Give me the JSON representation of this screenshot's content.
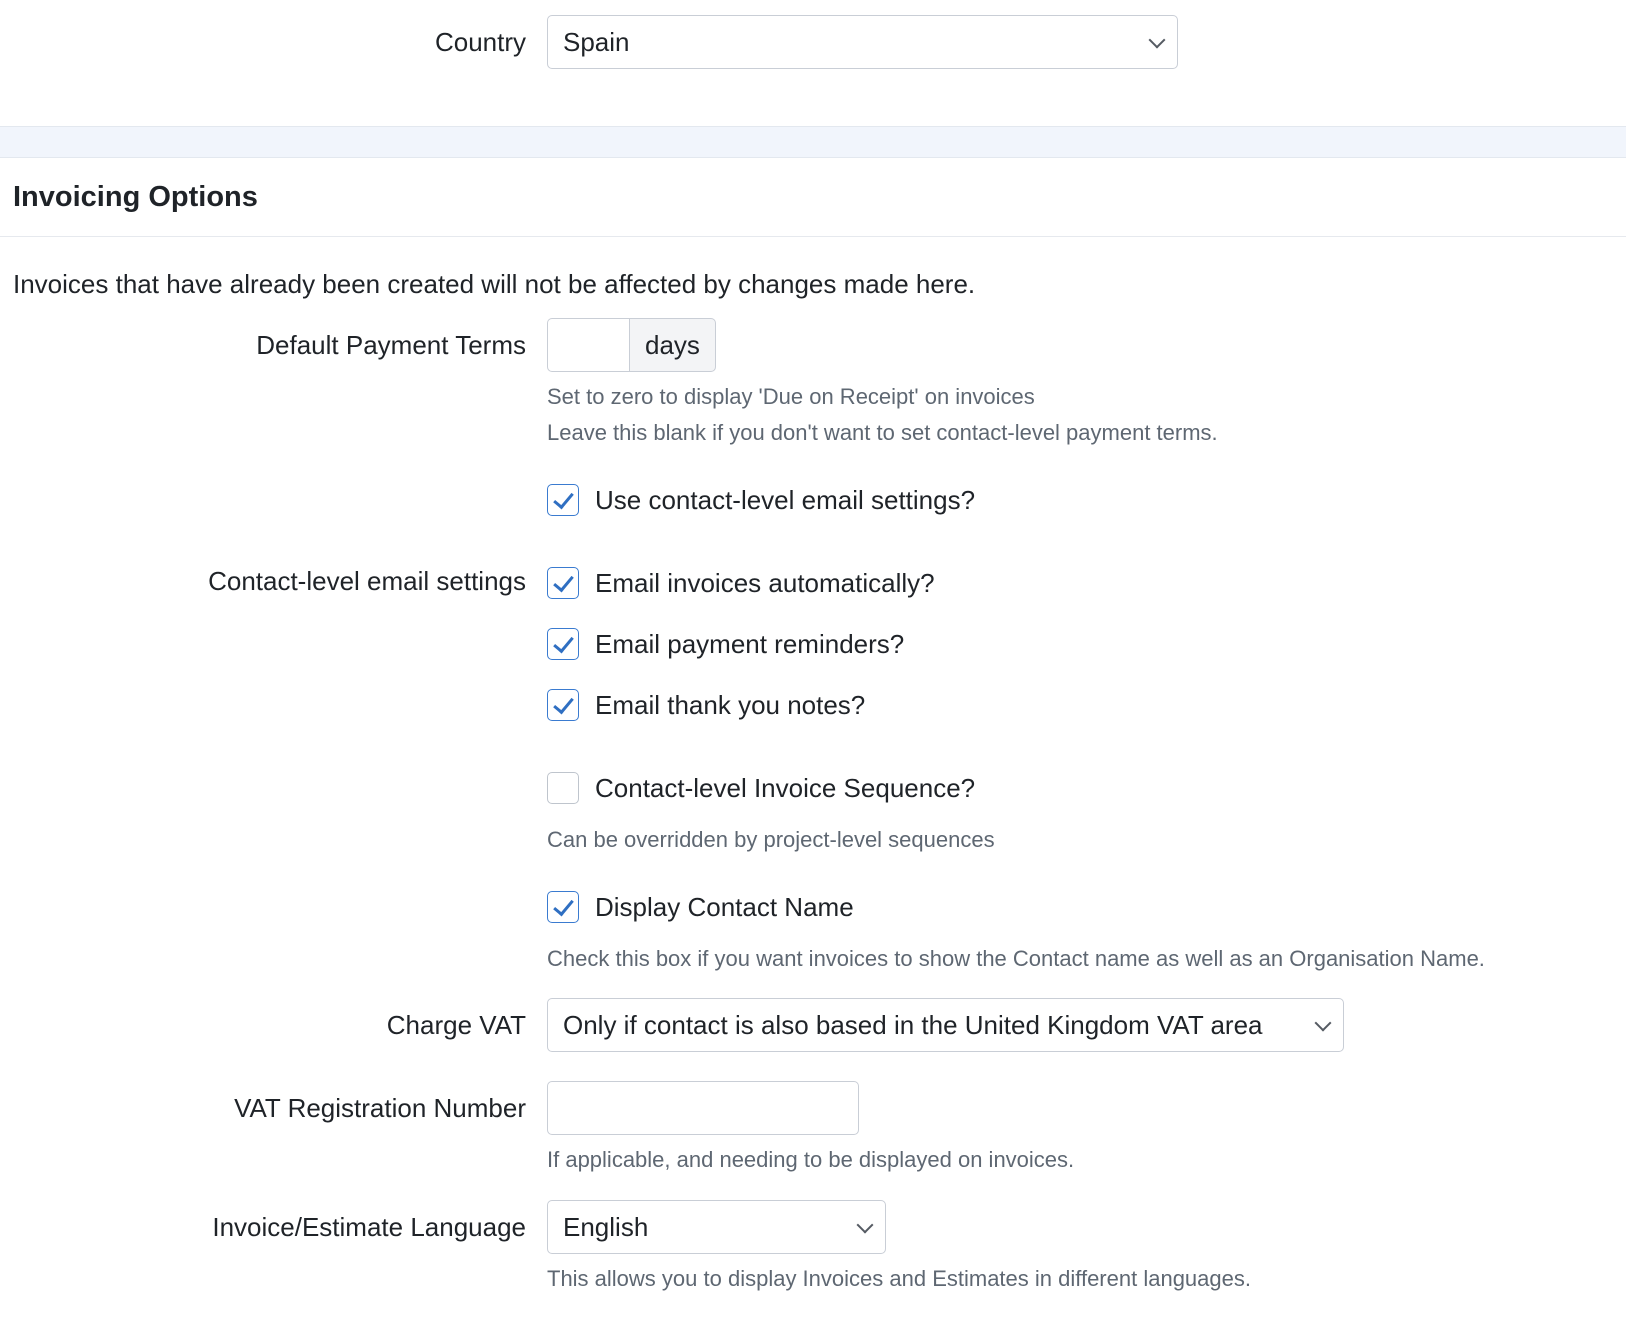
{
  "country": {
    "label": "Country",
    "value": "Spain"
  },
  "invoicing": {
    "title": "Invoicing Options",
    "intro": "Invoices that have already been created will not be affected by changes made here.",
    "payment_terms": {
      "label": "Default Payment Terms",
      "value": "",
      "addon": "days",
      "help_1": "Set to zero to display 'Due on Receipt' on invoices",
      "help_2": "Leave this blank if you don't want to set contact-level payment terms."
    },
    "use_contact_email": {
      "label": "Use contact-level email settings?",
      "checked": true
    },
    "contact_email_settings": {
      "label": "Contact-level email settings",
      "options": [
        {
          "label": "Email invoices automatically?",
          "checked": true
        },
        {
          "label": "Email payment reminders?",
          "checked": true
        },
        {
          "label": "Email thank you notes?",
          "checked": true
        }
      ]
    },
    "invoice_sequence": {
      "label": "Contact-level Invoice Sequence?",
      "checked": false,
      "help": "Can be overridden by project-level sequences"
    },
    "display_contact_name": {
      "label": "Display Contact Name",
      "checked": true,
      "help": "Check this box if you want invoices to show the Contact name as well as an Organisation Name."
    },
    "charge_vat": {
      "label": "Charge VAT",
      "value": "Only if contact is also based in the United Kingdom VAT area"
    },
    "vat_number": {
      "label": "VAT Registration Number",
      "value": "",
      "help": "If applicable, and needing to be displayed on invoices."
    },
    "language": {
      "label": "Invoice/Estimate Language",
      "value": "English",
      "help": "This allows you to display Invoices and Estimates in different languages."
    }
  },
  "icons": {
    "select_arrow": "chevron-down-icon",
    "check": "checkmark-icon"
  },
  "colors": {
    "accent": "#2f6fc2",
    "band": "#f1f5fc",
    "help_text": "#5e6772"
  }
}
